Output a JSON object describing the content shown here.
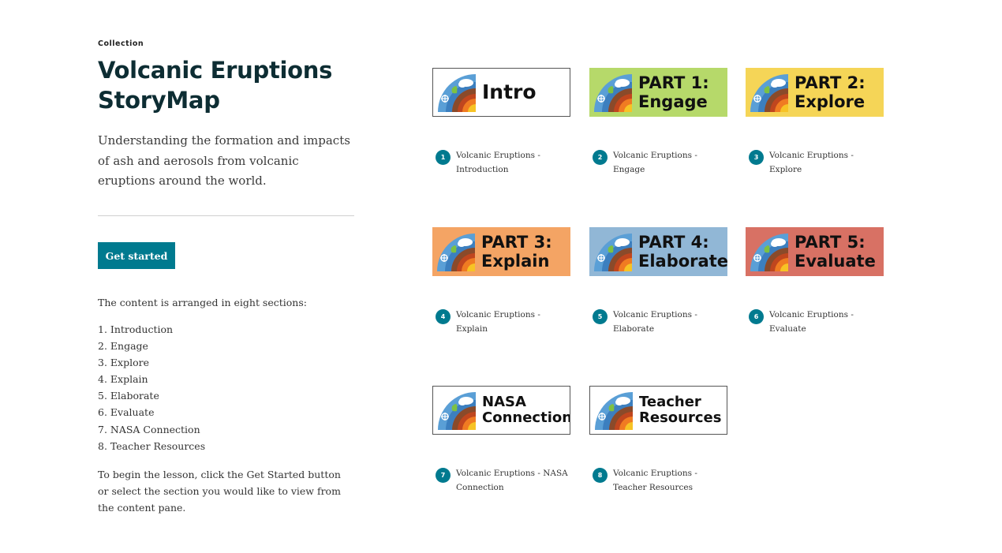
{
  "collection": {
    "eyebrow": "Collection",
    "title": "Volcanic Eruptions StoryMap",
    "subtitle": "Understanding the formation and impacts of ash and aerosols from volcanic eruptions around the world.",
    "get_started_label": "Get started",
    "intro_text": "The content is arranged in eight sections:",
    "sections": [
      "1. Introduction",
      "2. Engage",
      "3. Explore",
      "4. Explain",
      "5. Elaborate",
      "6. Evaluate",
      "7. NASA Connection",
      "8. Teacher Resources"
    ],
    "outro": "To begin the lesson, click the Get Started button or select the section you would like to view from the content pane."
  },
  "cards": [
    {
      "number": "1",
      "banner_lines": [
        "Intro"
      ],
      "label": "Volcanic Eruptions - Introduction",
      "bg": "#ffffff"
    },
    {
      "number": "2",
      "banner_lines": [
        "PART 1:",
        "Engage"
      ],
      "label": "Volcanic Eruptions - Engage",
      "bg": "#b6d96a"
    },
    {
      "number": "3",
      "banner_lines": [
        "PART 2:",
        "Explore"
      ],
      "label": "Volcanic Eruptions - Explore",
      "bg": "#f5d557"
    },
    {
      "number": "4",
      "banner_lines": [
        "PART 3:",
        "Explain"
      ],
      "label": "Volcanic Eruptions - Explain",
      "bg": "#f4a464"
    },
    {
      "number": "5",
      "banner_lines": [
        "PART 4:",
        "Elaborate"
      ],
      "label": "Volcanic Eruptions - Elaborate",
      "bg": "#91b7d6"
    },
    {
      "number": "6",
      "banner_lines": [
        "PART 5:",
        "Evaluate"
      ],
      "label": "Volcanic Eruptions - Evaluate",
      "bg": "#d87164"
    },
    {
      "number": "7",
      "banner_lines": [
        "NASA",
        "Connection"
      ],
      "label": "Volcanic Eruptions - NASA Connection",
      "bg": "#ffffff"
    },
    {
      "number": "8",
      "banner_lines": [
        "Teacher",
        "Resources"
      ],
      "label": "Volcanic Eruptions - Teacher Resources",
      "bg": "#ffffff"
    }
  ],
  "colors": {
    "accent": "#007a8f",
    "title": "#0d2d33"
  },
  "icons": {
    "banner_logo": "earth-layers-logo-icon"
  }
}
